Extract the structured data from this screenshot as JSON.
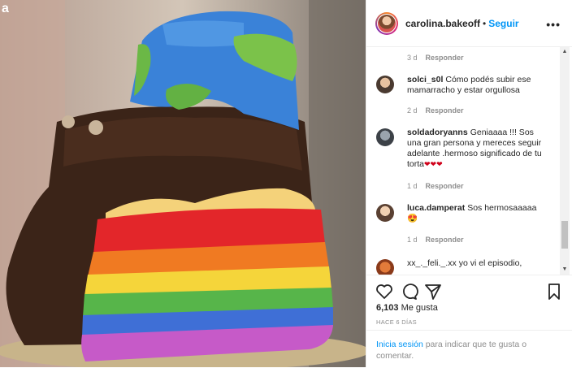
{
  "photo": {
    "watermark": "a"
  },
  "header": {
    "username": "carolina.bakeoff",
    "separator": "•",
    "follow_label": "Seguir",
    "more_icon": "more-dots-icon"
  },
  "comments": [
    {
      "user": "",
      "text": "",
      "time": "3 d",
      "reply": "Responder"
    },
    {
      "user": "solci_s0l",
      "text": "Cómo podés subir ese mamarracho y estar orgullosa",
      "time": "2 d",
      "reply": "Responder"
    },
    {
      "user": "soldadoryanns",
      "text": "Geniaaaa !!! Sos una gran persona y mereces seguir adelante .hermoso significado de tu torta",
      "emoji": "❤❤❤",
      "time": "1 d",
      "reply": "Responder"
    },
    {
      "user": "luca.damperat",
      "text": "Sos hermosaaaaa",
      "emoji": "😍",
      "time": "1 d",
      "reply": "Responder"
    },
    {
      "user": "xx_._feli._.xx",
      "text": "yo vi el episodio,",
      "time": "",
      "reply": ""
    }
  ],
  "actions": {
    "like_icon": "heart-icon",
    "comment_icon": "comment-icon",
    "share_icon": "share-icon",
    "save_icon": "bookmark-icon"
  },
  "likes": {
    "count": "6,103",
    "label": "Me gusta"
  },
  "posted_ago": "HACE 6 DÍAS",
  "login": {
    "link": "Inicia sesión",
    "rest": " para indicar que te gusta o comentar."
  },
  "colors": {
    "accent": "#0095f6",
    "text": "#262626",
    "muted": "#8e8e8e",
    "heart": "#d0021b"
  }
}
